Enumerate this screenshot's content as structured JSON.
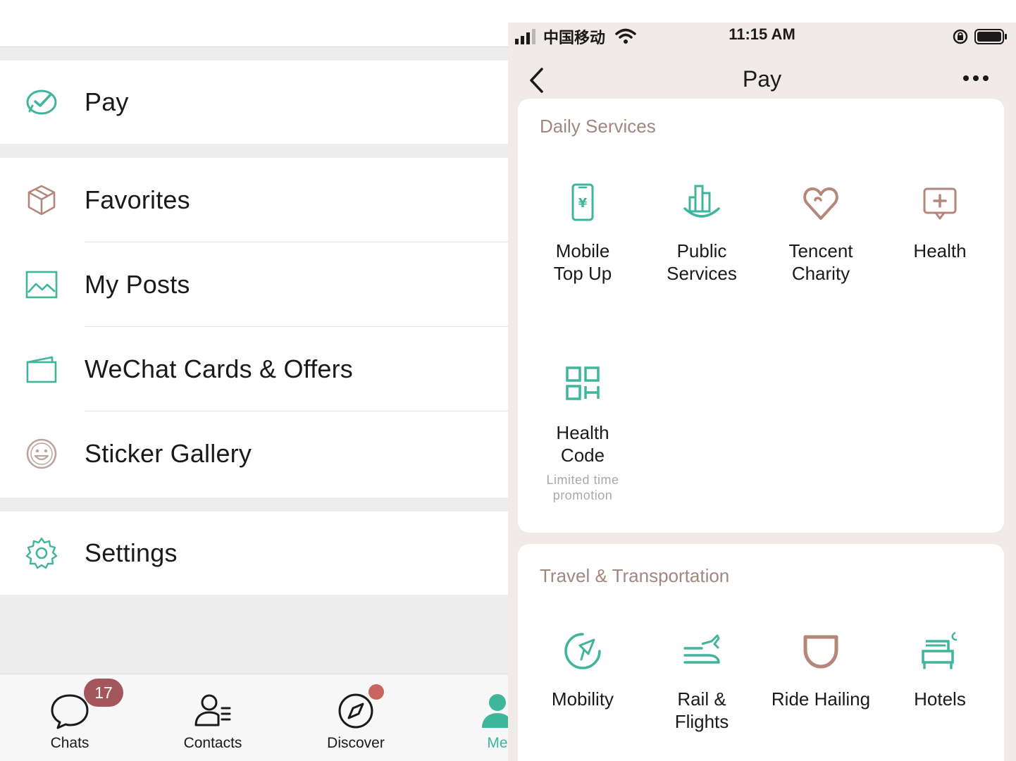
{
  "left_panel": {
    "menu": {
      "pay": "Pay",
      "favorites": "Favorites",
      "my_posts": "My Posts",
      "cards_offers": "WeChat Cards & Offers",
      "sticker_gallery": "Sticker Gallery",
      "settings": "Settings"
    },
    "tabbar": {
      "chats": "Chats",
      "chats_badge": "17",
      "contacts": "Contacts",
      "discover": "Discover",
      "me": "Me"
    }
  },
  "right_panel": {
    "status_bar": {
      "carrier": "中国移动",
      "time": "11:15 AM"
    },
    "nav": {
      "title": "Pay"
    },
    "daily_services": {
      "title": "Daily Services",
      "items": [
        {
          "label": "Mobile\nTop Up",
          "icon": "mobile-topup-icon"
        },
        {
          "label": "Public\nServices",
          "icon": "public-services-icon"
        },
        {
          "label": "Tencent\nCharity",
          "icon": "charity-icon"
        },
        {
          "label": "Health",
          "icon": "health-icon"
        },
        {
          "label": "Health\nCode",
          "icon": "health-code-icon",
          "note": "Limited time\npromotion"
        }
      ]
    },
    "travel": {
      "title": "Travel & Transportation",
      "items": [
        {
          "label": "Mobility",
          "icon": "mobility-icon"
        },
        {
          "label": "Rail &\nFlights",
          "icon": "rail-flights-icon"
        },
        {
          "label": "Ride Hailing",
          "icon": "ride-hailing-icon"
        },
        {
          "label": "Hotels",
          "icon": "hotels-icon"
        }
      ]
    }
  },
  "colors": {
    "accent_green": "#3fb69c",
    "accent_brown": "#b4877a",
    "badge": "#a3575c",
    "section_title": "#a0887e"
  }
}
